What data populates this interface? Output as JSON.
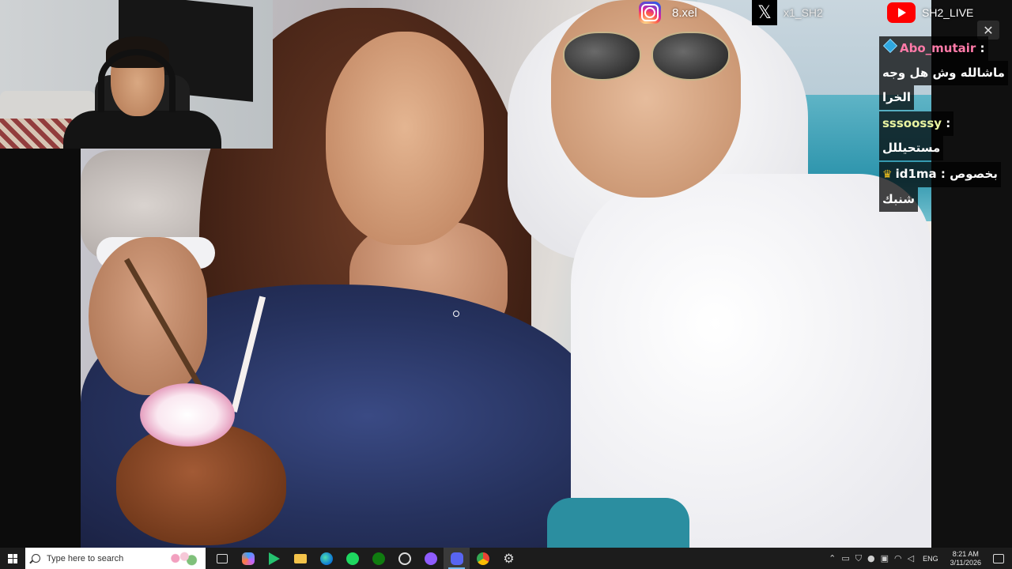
{
  "social": {
    "instagram_handle": "8.xel",
    "x_handle": "x1_SH2",
    "youtube_channel": "SH2_LIVE"
  },
  "close_glyph": "✕",
  "chat": {
    "messages": [
      {
        "user": "Abo_mutair",
        "separator": ":",
        "text": "ماشالله وش هل وجه",
        "text_cont": "الخرا",
        "user_color": "#ff7aa8",
        "badge": "cube-badge-icon"
      },
      {
        "user": "sssoossy",
        "separator": ":",
        "text": "مستحيللل",
        "user_color": "#e9f3a0"
      },
      {
        "user": "id1ma",
        "separator": ":",
        "text_before": "بخصوص",
        "text": "شنبك",
        "user_color": "#ffffff",
        "badge": "crown-badge-icon"
      }
    ]
  },
  "taskbar": {
    "search_placeholder": "Type here to search",
    "language": "ENG",
    "time": "8:21 AM",
    "date": "3/11/2026",
    "apps": [
      "task-view",
      "copilot",
      "google-play-games",
      "file-explorer",
      "edge",
      "spotify",
      "xbox",
      "obs",
      "app",
      "discord",
      "chrome",
      "settings"
    ]
  },
  "x_glyph": "𝕏",
  "gear_glyph": "⚙"
}
